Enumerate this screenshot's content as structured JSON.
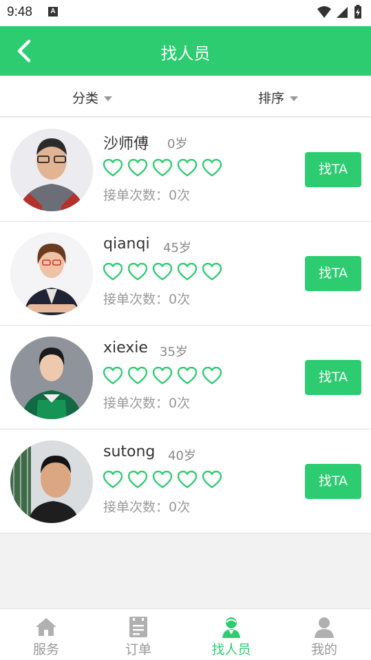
{
  "status_bar": {
    "time": "9:48",
    "notif_icon": "A"
  },
  "header": {
    "title": "找人员"
  },
  "filters": {
    "category": "分类",
    "sort": "排序"
  },
  "colors": {
    "accent": "#2ecc71",
    "heart": "#2ecc71"
  },
  "workers": [
    {
      "name": "沙师傅",
      "age": "0岁",
      "rating": 5,
      "orders": "接单次数：0次",
      "button": "找TA"
    },
    {
      "name": "qianqi",
      "age": "45岁",
      "rating": 5,
      "orders": "接单次数：0次",
      "button": "找TA"
    },
    {
      "name": "xiexie",
      "age": "35岁",
      "rating": 5,
      "orders": "接单次数：0次",
      "button": "找TA"
    },
    {
      "name": "sutong",
      "age": "40岁",
      "rating": 5,
      "orders": "接单次数：0次",
      "button": "找TA"
    }
  ],
  "tabbar": {
    "items": [
      {
        "label": "服务",
        "icon": "home-icon"
      },
      {
        "label": "订单",
        "icon": "order-icon"
      },
      {
        "label": "找人员",
        "icon": "find-person-icon",
        "active": true
      },
      {
        "label": "我的",
        "icon": "user-icon"
      }
    ]
  }
}
